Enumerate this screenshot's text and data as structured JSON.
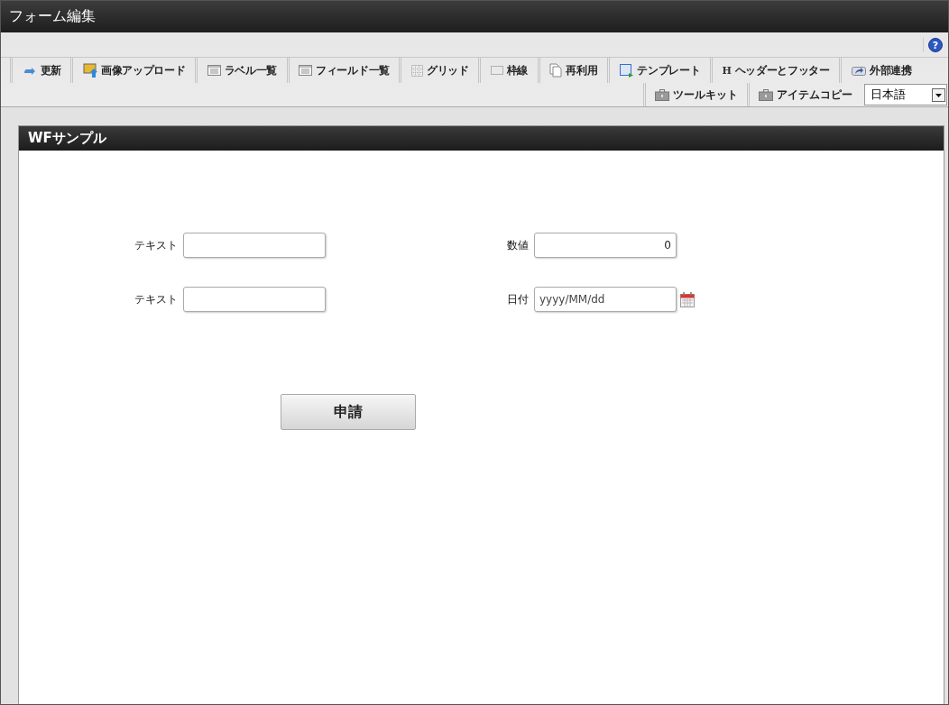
{
  "window": {
    "title": "フォーム編集"
  },
  "toolbar": {
    "help_icon": "?",
    "tabs": [
      {
        "label": "更新"
      },
      {
        "label": "画像アップロード"
      },
      {
        "label": "ラベル一覧"
      },
      {
        "label": "フィールド一覧"
      },
      {
        "label": "グリッド"
      },
      {
        "label": "枠線"
      },
      {
        "label": "再利用"
      },
      {
        "label": "テンプレート"
      },
      {
        "label": "ヘッダーとフッター",
        "icon_glyph": "H"
      },
      {
        "label": "外部連携"
      }
    ],
    "tabs_row_2": [
      {
        "label": "ツールキット"
      },
      {
        "label": "アイテムコピー"
      }
    ],
    "language": {
      "value": "日本語"
    }
  },
  "form": {
    "title": "WFサンプル",
    "fields": [
      {
        "label": "テキスト"
      },
      {
        "label": "数値",
        "value": "0",
        "kind": "number"
      },
      {
        "label": "テキスト"
      },
      {
        "label": "日付",
        "placeholder": "yyyy/MM/dd",
        "kind": "date"
      }
    ],
    "submit_button": "申請"
  }
}
